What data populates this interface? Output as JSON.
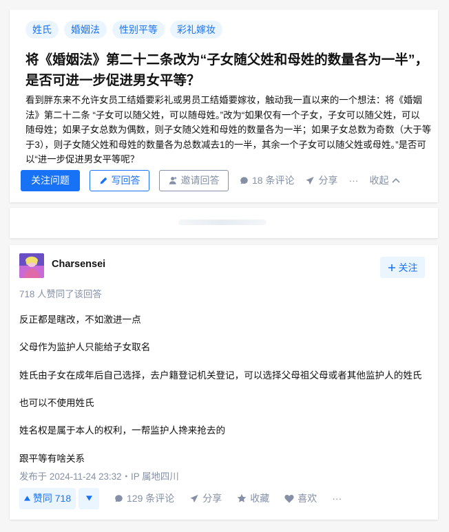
{
  "question": {
    "tags": [
      "姓氏",
      "婚姻法",
      "性别平等",
      "彩礼嫁妆"
    ],
    "title_line1": "将《婚姻法》第二十二条改为“子女随父姓和母姓的数量各为一半”，",
    "title_line2": "是否可进一步促进男女平等？",
    "desc_lines": [
      "看到胖东来不允许女员工结婚要彩礼或男员工结婚要嫁妆，触动我一直以来的一个想法：将《婚姻",
      "法》第二十二条 “子女可以随父姓，可以随母姓。”改为“如果仅有一个子女，子女可以随父姓，可以",
      "随母姓；如果子女总数为偶数，则子女随父姓和母姓的数量各为一半；如果子女总数为奇数（大于等",
      "于3），则子女随父姓和母姓的数量各为总数减去1的一半，其余一个子女可以随父姓或母姓。”是否可",
      "以“进一步促进男女平等呢？"
    ],
    "actions": {
      "follow": "关注问题",
      "write": "写回答",
      "invite": "邀请回答",
      "comments": "18 条评论",
      "share": "分享",
      "more": "···",
      "collapse": "收起"
    }
  },
  "answer": {
    "author": "Charsensei",
    "follow": "关注",
    "voters": "718 人赞同了该回答",
    "paragraphs": [
      "反正都是瞎改，不如激进一点",
      "父母作为监护人只能给子女取名",
      "姓氏由子女在成年后自己选择，去户籍登记机关登记，可以选择父母祖父母或者其他监护人的姓氏",
      "也可以不使用姓氏",
      "姓名权是属于本人的权利，一帮监护人搀来抢去的",
      "跟平等有啥关系"
    ],
    "post_time": "发布于 2024-11-24 23:32・IP 属地四川",
    "actions": {
      "vote_up": "赞同 718",
      "comments": "129 条评论",
      "share": "分享",
      "favorite": "收藏",
      "like": "喜欢",
      "more": "···"
    }
  },
  "colors": {
    "brand": "#1772f6",
    "brand_bg": "#ebf5ff",
    "muted": "#8590a6"
  }
}
